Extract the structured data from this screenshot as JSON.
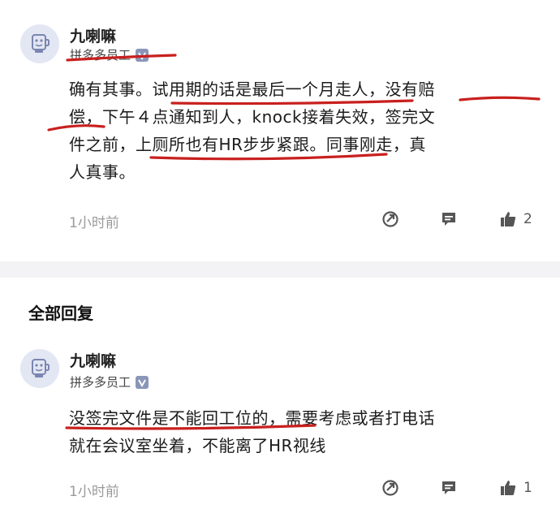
{
  "comment": {
    "author": "九喇嘛",
    "role": "拼多多员工",
    "text_lines": [
      "确有其事。试用期的话是最后一个月走人，没有赔",
      "偿，下午４点通知到人，knock接着失效，签完文",
      "件之前，上厕所也有HR步步紧跟。同事刚走，真",
      "人真事。"
    ],
    "time": "1小时前",
    "like_count": "2"
  },
  "replies_header": "全部回复",
  "reply": {
    "author": "九喇嘛",
    "role": "拼多多员工",
    "text_lines": [
      "没签完文件是不能回工位的，需要考虑或者打电话",
      "就在会议室坐着，不能离了HR视线"
    ],
    "time": "1小时前",
    "like_count": "1"
  },
  "colors": {
    "highlight_underline": "#c8201e",
    "avatar_bg": "#e3e6f3",
    "badge": "#8a96b8"
  },
  "icons": [
    "avatar-robot-icon",
    "verified-badge-icon",
    "share-icon",
    "comment-icon",
    "thumbs-up-icon"
  ]
}
